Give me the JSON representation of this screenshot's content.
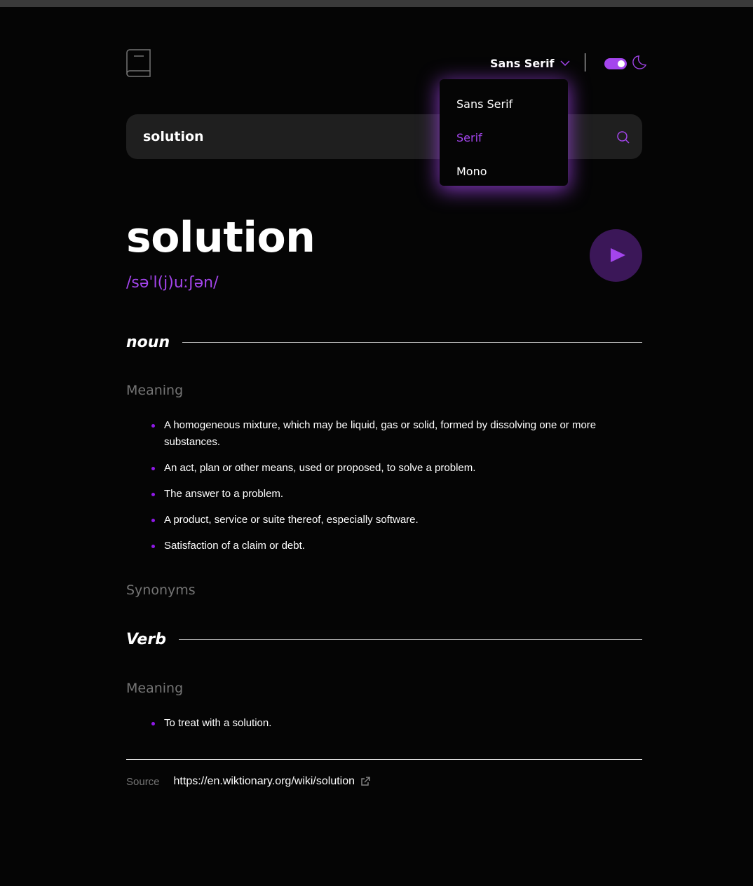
{
  "header": {
    "font_selected": "Sans Serif",
    "logo_icon": "book-icon",
    "theme_toggle": "on",
    "theme_icon": "moon-icon"
  },
  "font_dropdown": {
    "options": [
      "Sans Serif",
      "Serif",
      "Mono"
    ],
    "active": "Serif"
  },
  "search": {
    "value": "solution",
    "icon": "search-icon"
  },
  "word": {
    "text": "solution",
    "phonetic": "/səˈl(j)uːʃən/",
    "play_icon": "play-icon"
  },
  "meanings": [
    {
      "part_of_speech": "noun",
      "heading": "Meaning",
      "definitions": [
        "A homogeneous mixture, which may be liquid, gas or solid, formed by dissolving one or more substances.",
        "An act, plan or other means, used or proposed, to solve a problem.",
        "The answer to a problem.",
        "A product, service or suite thereof, especially software.",
        "Satisfaction of a claim or debt."
      ],
      "synonyms_label": "Synonyms"
    },
    {
      "part_of_speech": "Verb",
      "heading": "Meaning",
      "definitions": [
        "To treat with a solution."
      ]
    }
  ],
  "source": {
    "label": "Source",
    "url": "https://en.wiktionary.org/wiki/solution",
    "icon": "external-link-icon"
  },
  "colors": {
    "accent": "#a445ed",
    "background": "#050505",
    "surface": "#1f1f1f",
    "muted": "#757575"
  }
}
